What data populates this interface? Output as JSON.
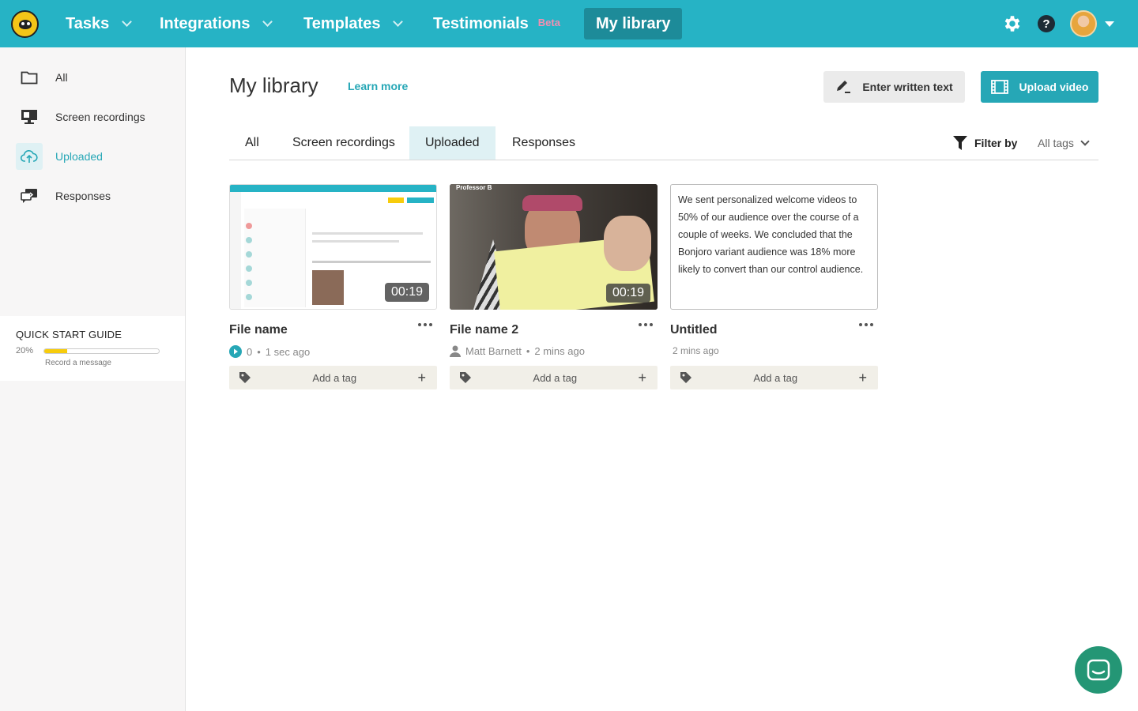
{
  "nav": {
    "tasks": "Tasks",
    "integrations": "Integrations",
    "templates": "Templates",
    "testimonials": "Testimonials",
    "beta": "Beta",
    "my_library": "My library",
    "help": "?"
  },
  "sidebar": {
    "items": [
      {
        "label": "All"
      },
      {
        "label": "Screen recordings"
      },
      {
        "label": "Uploaded"
      },
      {
        "label": "Responses"
      }
    ],
    "quick_start": {
      "title": "QUICK START GUIDE",
      "percent": "20%",
      "progress": 0.2,
      "subtitle": "Record a message"
    }
  },
  "main": {
    "title": "My library",
    "learn_more": "Learn more",
    "enter_text_button": "Enter written text",
    "upload_button": "Upload video",
    "tabs": [
      {
        "label": "All"
      },
      {
        "label": "Screen recordings"
      },
      {
        "label": "Uploaded"
      },
      {
        "label": "Responses"
      }
    ],
    "filter_label": "Filter by",
    "tags_select": "All tags"
  },
  "cards": [
    {
      "title": "File name",
      "duration": "00:19",
      "views": "0",
      "time": "1 sec ago",
      "tag_label": "Add a tag"
    },
    {
      "title": "File name 2",
      "duration": "00:19",
      "author": "Matt Barnett",
      "time": "2 mins ago",
      "tag_label": "Add a tag",
      "overlay_name": "Professor B"
    },
    {
      "title": "Untitled",
      "text": "We sent personalized welcome videos to 50% of our audience over the course of a couple of weeks. We concluded that the Bonjoro variant audience was 18% more likely to convert than our control audience.",
      "time": "2 mins ago",
      "tag_label": "Add a tag"
    }
  ],
  "colors": {
    "brand": "#26b3c5",
    "accent": "#26a7b6",
    "progress": "#f7cc0c",
    "chat": "#249675"
  }
}
